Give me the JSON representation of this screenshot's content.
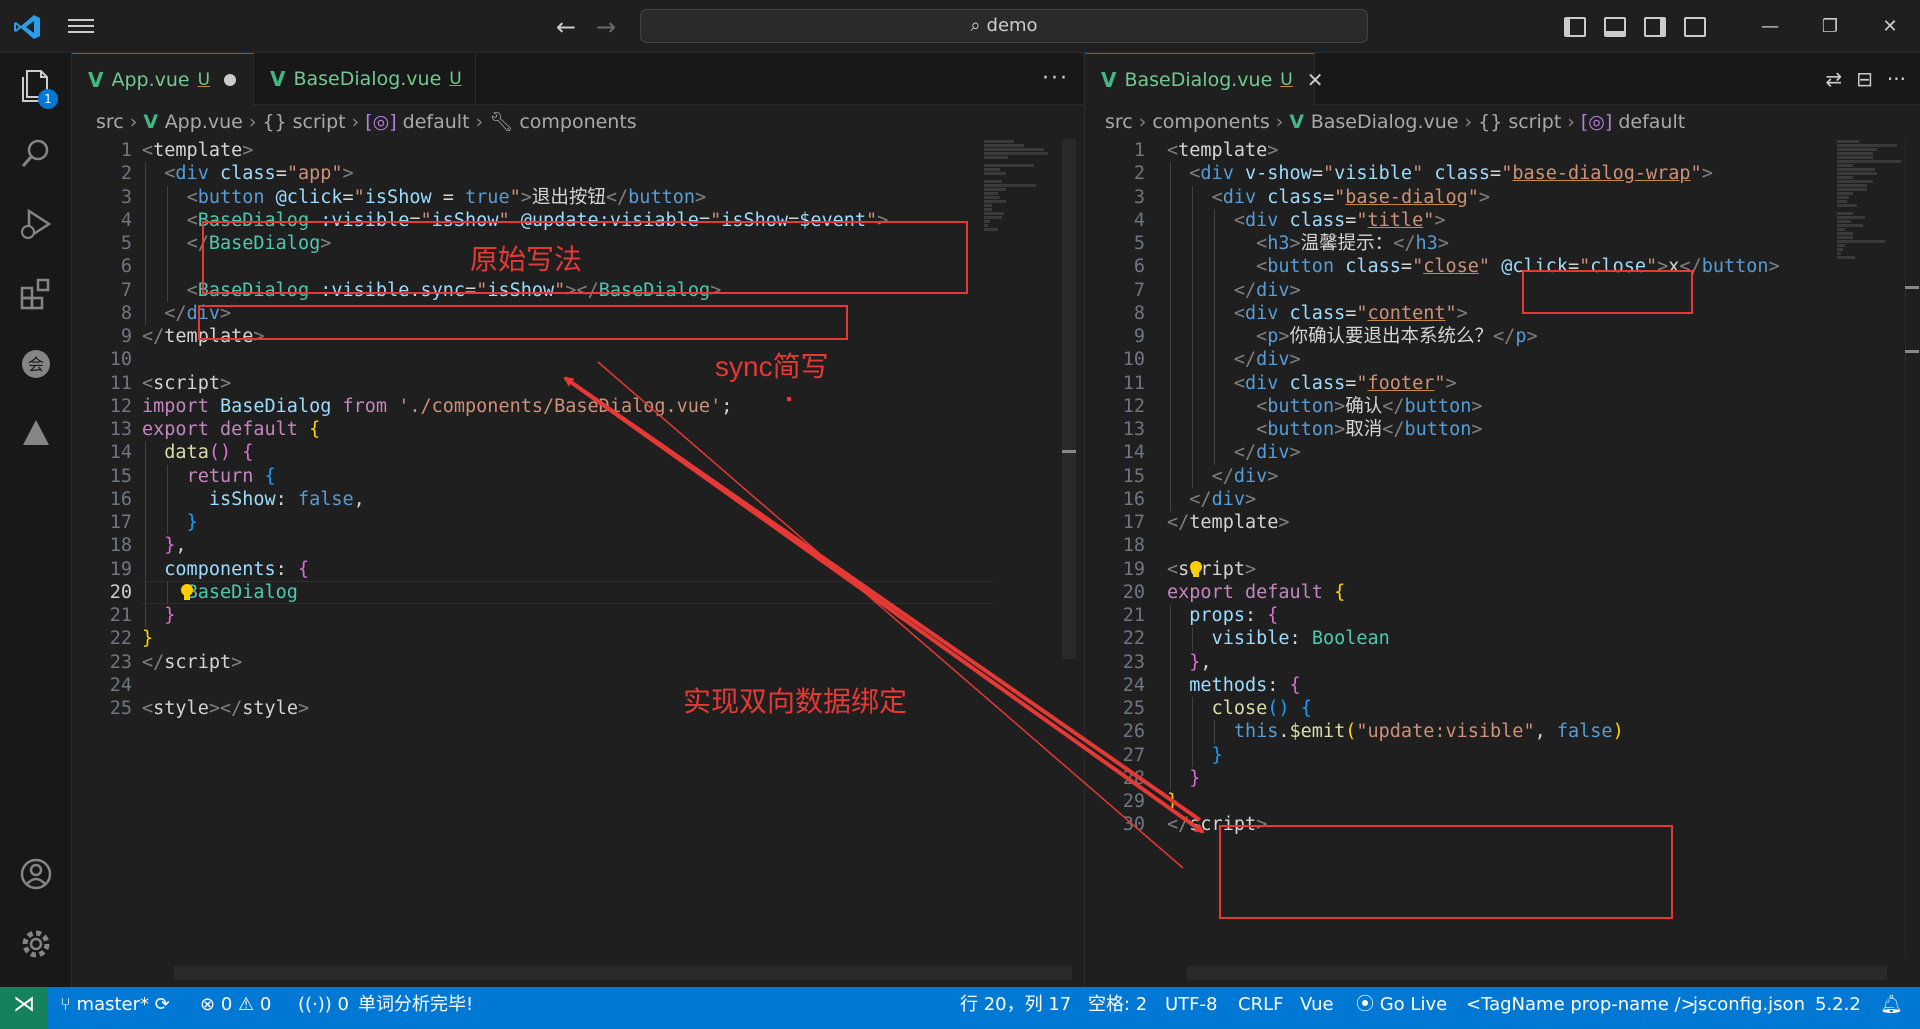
{
  "titlebar": {
    "search": "demo"
  },
  "activity": {
    "explorer_badge": "1"
  },
  "left_editor": {
    "tabs": [
      {
        "label": "App.vue",
        "status": "U",
        "state": "modified"
      },
      {
        "label": "BaseDialog.vue",
        "status": "U"
      }
    ],
    "breadcrumb": [
      "src",
      "App.vue",
      "{} script",
      "default",
      "components"
    ],
    "lines": [
      {
        "n": "1",
        "html": "<span class=\"p\">&lt;</span><span class=\"w\">template</span><span class=\"p\">&gt;</span>"
      },
      {
        "n": "2",
        "html": "  <span class=\"p\">&lt;</span><span class=\"t\">div</span> <span class=\"a\">class</span><span class=\"w\">=</span><span class=\"s\">\"app\"</span><span class=\"p\">&gt;</span>"
      },
      {
        "n": "3",
        "html": "    <span class=\"p\">&lt;</span><span class=\"t\">button</span> <span class=\"a\">@click</span><span class=\"w\">=</span><span class=\"s\">\"</span><span class=\"a\">isShow</span> <span class=\"w\">=</span> <span class=\"kb\">true</span><span class=\"s\">\"</span><span class=\"p\">&gt;</span><span class=\"w\">退出按钮</span><span class=\"p\">&lt;/</span><span class=\"t\">button</span><span class=\"p\">&gt;</span>"
      },
      {
        "n": "4",
        "html": "    <span class=\"p\">&lt;</span><span class=\"c\">BaseDialog</span> <span class=\"a\">:visible</span><span class=\"w\">=</span><span class=\"s\">\"</span><span class=\"a\">isShow</span><span class=\"s\">\"</span> <span class=\"a\">@update:visiable</span><span class=\"w\">=</span><span class=\"s\">\"</span><span class=\"a\">isShow</span><span class=\"w\">=</span><span class=\"a\">$event</span><span class=\"s\">\"</span><span class=\"p\">&gt;</span>"
      },
      {
        "n": "5",
        "html": "    <span class=\"p\">&lt;/</span><span class=\"c\">BaseDialog</span><span class=\"p\">&gt;</span>"
      },
      {
        "n": "6",
        "html": ""
      },
      {
        "n": "7",
        "html": "    <span class=\"p\">&lt;</span><span class=\"c\">BaseDialog</span> <span class=\"a\">:visible</span><span class=\"w\">.</span><span class=\"a\">sync</span><span class=\"w\">=</span><span class=\"s\">\"</span><span class=\"a\">isShow</span><span class=\"s\">\"</span><span class=\"p\">&gt;&lt;/</span><span class=\"c\">BaseDialog</span><span class=\"p\">&gt;</span>"
      },
      {
        "n": "8",
        "html": "  <span class=\"p\">&lt;/</span><span class=\"t\">div</span><span class=\"p\">&gt;</span>"
      },
      {
        "n": "9",
        "html": "<span class=\"p\">&lt;/</span><span class=\"w\">template</span><span class=\"p\">&gt;</span>"
      },
      {
        "n": "10",
        "html": ""
      },
      {
        "n": "11",
        "html": "<span class=\"p\">&lt;</span><span class=\"w\">script</span><span class=\"p\">&gt;</span>"
      },
      {
        "n": "12",
        "html": "<span class=\"k\">import</span> <span class=\"a\">BaseDialog</span> <span class=\"k\">from</span> <span class=\"s\">'./components/BaseDialog.vue'</span><span class=\"w\">;</span>"
      },
      {
        "n": "13",
        "html": "<span class=\"k\">export</span> <span class=\"k\">default</span> <span class=\"y\">{</span>"
      },
      {
        "n": "14",
        "html": "  <span class=\"f\">data</span><span class=\"pk\">()</span> <span class=\"pk\">{</span>"
      },
      {
        "n": "15",
        "html": "    <span class=\"k\">return</span> <span class=\"bl\">{</span>"
      },
      {
        "n": "16",
        "html": "      <span class=\"a\">isShow</span><span class=\"w\">:</span> <span class=\"kb\">false</span><span class=\"w\">,</span>"
      },
      {
        "n": "17",
        "html": "    <span class=\"bl\">}</span>"
      },
      {
        "n": "18",
        "html": "  <span class=\"pk\">}</span><span class=\"w\">,</span>"
      },
      {
        "n": "19",
        "html": "  <span class=\"a\">components</span><span class=\"w\">:</span> <span class=\"pk\">{</span>"
      },
      {
        "n": "20",
        "html": "    <span class=\"c\">BaseDialog</span>"
      },
      {
        "n": "21",
        "html": "  <span class=\"pk\">}</span>"
      },
      {
        "n": "22",
        "html": "<span class=\"y\">}</span>"
      },
      {
        "n": "23",
        "html": "<span class=\"p\">&lt;/</span><span class=\"w\">script</span><span class=\"p\">&gt;</span>"
      },
      {
        "n": "24",
        "html": ""
      },
      {
        "n": "25",
        "html": "<span class=\"p\">&lt;</span><span class=\"w\">style</span><span class=\"p\">&gt;&lt;/</span><span class=\"w\">style</span><span class=\"p\">&gt;</span>"
      }
    ]
  },
  "right_editor": {
    "tabs": [
      {
        "label": "BaseDialog.vue",
        "status": "U",
        "state": "close"
      }
    ],
    "breadcrumb": [
      "src",
      "components",
      "BaseDialog.vue",
      "{} script",
      "default"
    ],
    "lines": [
      {
        "n": "1",
        "html": "<span class=\"p\">&lt;</span><span class=\"w\">template</span><span class=\"p\">&gt;</span>"
      },
      {
        "n": "2",
        "html": "  <span class=\"p\">&lt;</span><span class=\"t\">div</span> <span class=\"a\">v-show</span><span class=\"w\">=</span><span class=\"s\">\"</span><span class=\"a\">visible</span><span class=\"s\">\"</span> <span class=\"a\">class</span><span class=\"w\">=</span><span class=\"s\">\"<span class=\"u\">base-dialog-wrap</span>\"</span><span class=\"p\">&gt;</span>"
      },
      {
        "n": "3",
        "html": "    <span class=\"p\">&lt;</span><span class=\"t\">div</span> <span class=\"a\">class</span><span class=\"w\">=</span><span class=\"s\">\"<span class=\"u\">base-dialog</span>\"</span><span class=\"p\">&gt;</span>"
      },
      {
        "n": "4",
        "html": "      <span class=\"p\">&lt;</span><span class=\"t\">div</span> <span class=\"a\">class</span><span class=\"w\">=</span><span class=\"s\">\"<span class=\"u\">title</span>\"</span><span class=\"p\">&gt;</span>"
      },
      {
        "n": "5",
        "html": "        <span class=\"p\">&lt;</span><span class=\"t\">h3</span><span class=\"p\">&gt;</span><span class=\"w\">温馨提示：</span><span class=\"p\">&lt;/</span><span class=\"t\">h3</span><span class=\"p\">&gt;</span>"
      },
      {
        "n": "6",
        "html": "        <span class=\"p\">&lt;</span><span class=\"t\">button</span> <span class=\"a\">class</span><span class=\"w\">=</span><span class=\"s\">\"<span class=\"u\">close</span>\"</span> <span class=\"a\">@click</span><span class=\"w\">=</span><span class=\"s\">\"</span><span class=\"a\">close</span><span class=\"s\">\"</span><span class=\"p\">&gt;</span><span class=\"w\">x</span><span class=\"p\">&lt;/</span><span class=\"t\">button</span><span class=\"p\">&gt;</span>"
      },
      {
        "n": "7",
        "html": "      <span class=\"p\">&lt;/</span><span class=\"t\">div</span><span class=\"p\">&gt;</span>"
      },
      {
        "n": "8",
        "html": "      <span class=\"p\">&lt;</span><span class=\"t\">div</span> <span class=\"a\">class</span><span class=\"w\">=</span><span class=\"s\">\"<span class=\"u\">content</span>\"</span><span class=\"p\">&gt;</span>"
      },
      {
        "n": "9",
        "html": "        <span class=\"p\">&lt;</span><span class=\"t\">p</span><span class=\"p\">&gt;</span><span class=\"w\">你确认要退出本系统么？</span><span class=\"p\">&lt;/</span><span class=\"t\">p</span><span class=\"p\">&gt;</span>"
      },
      {
        "n": "10",
        "html": "      <span class=\"p\">&lt;/</span><span class=\"t\">div</span><span class=\"p\">&gt;</span>"
      },
      {
        "n": "11",
        "html": "      <span class=\"p\">&lt;</span><span class=\"t\">div</span> <span class=\"a\">class</span><span class=\"w\">=</span><span class=\"s\">\"<span class=\"u\">footer</span>\"</span><span class=\"p\">&gt;</span>"
      },
      {
        "n": "12",
        "html": "        <span class=\"p\">&lt;</span><span class=\"t\">button</span><span class=\"p\">&gt;</span><span class=\"w\">确认</span><span class=\"p\">&lt;/</span><span class=\"t\">button</span><span class=\"p\">&gt;</span>"
      },
      {
        "n": "13",
        "html": "        <span class=\"p\">&lt;</span><span class=\"t\">button</span><span class=\"p\">&gt;</span><span class=\"w\">取消</span><span class=\"p\">&lt;/</span><span class=\"t\">button</span><span class=\"p\">&gt;</span>"
      },
      {
        "n": "14",
        "html": "      <span class=\"p\">&lt;/</span><span class=\"t\">div</span><span class=\"p\">&gt;</span>"
      },
      {
        "n": "15",
        "html": "    <span class=\"p\">&lt;/</span><span class=\"t\">div</span><span class=\"p\">&gt;</span>"
      },
      {
        "n": "16",
        "html": "  <span class=\"p\">&lt;/</span><span class=\"t\">div</span><span class=\"p\">&gt;</span>"
      },
      {
        "n": "17",
        "html": "<span class=\"p\">&lt;/</span><span class=\"w\">template</span><span class=\"p\">&gt;</span>"
      },
      {
        "n": "18",
        "html": ""
      },
      {
        "n": "19",
        "html": "<span class=\"p\">&lt;</span><span class=\"w\">script</span><span class=\"p\">&gt;</span>"
      },
      {
        "n": "20",
        "html": "<span class=\"k\">export</span> <span class=\"k\">default</span> <span class=\"y\">{</span>"
      },
      {
        "n": "21",
        "html": "  <span class=\"a\">props</span><span class=\"w\">:</span> <span class=\"pk\">{</span>"
      },
      {
        "n": "22",
        "html": "    <span class=\"a\">visible</span><span class=\"w\">:</span> <span class=\"c\">Boolean</span>"
      },
      {
        "n": "23",
        "html": "  <span class=\"pk\">}</span><span class=\"w\">,</span>"
      },
      {
        "n": "24",
        "html": "  <span class=\"a\">methods</span><span class=\"w\">:</span> <span class=\"pk\">{</span>"
      },
      {
        "n": "25",
        "html": "    <span class=\"f\">close</span><span class=\"bl\">()</span> <span class=\"bl\">{</span>"
      },
      {
        "n": "26",
        "html": "      <span class=\"kb\">this</span><span class=\"w\">.</span><span class=\"f\">$emit</span><span class=\"y\">(</span><span class=\"s\">\"update:visible\"</span><span class=\"w\">,</span> <span class=\"kb\">false</span><span class=\"y\">)</span>"
      },
      {
        "n": "27",
        "html": "    <span class=\"bl\">}</span>"
      },
      {
        "n": "28",
        "html": "  <span class=\"pk\">}</span>"
      },
      {
        "n": "29",
        "html": "<span class=\"y\">}</span>"
      },
      {
        "n": "30",
        "html": "<span class=\"p\">&lt;/</span><span class=\"w\">script</span><span class=\"p\">&gt;</span>"
      }
    ]
  },
  "annotations": {
    "original": "原始写法",
    "sync": "sync简写",
    "binding": "实现双向数据绑定"
  },
  "statusbar": {
    "branch": "master*",
    "errors": "0",
    "warnings": "0",
    "ports": "0",
    "message": "单词分析完毕!",
    "position": "行 20，列 17",
    "spaces": "空格: 2",
    "encoding": "UTF-8",
    "eol": "CRLF",
    "language": "Vue",
    "golive": "Go Live",
    "tagname": "<TagName prop-name />",
    "config": "jsconfig.json",
    "version": "5.2.2"
  },
  "colors": {
    "accent": "#0078d4",
    "annotation_red": "#e53935",
    "remote": "#16825d"
  }
}
